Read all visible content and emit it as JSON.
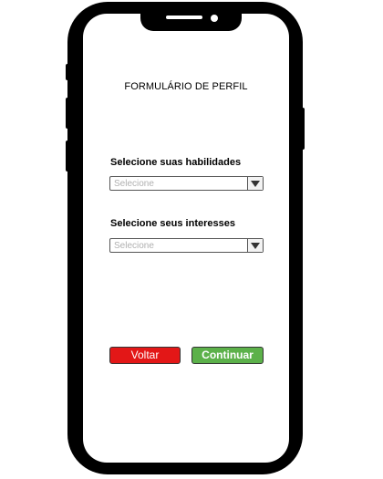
{
  "form": {
    "title": "FORMULÁRIO DE PERFIL",
    "skills": {
      "label": "Selecione suas habilidades",
      "placeholder": "Selecione"
    },
    "interests": {
      "label": "Selecione seus interesses",
      "placeholder": "Selecione"
    }
  },
  "actions": {
    "back_label": "Voltar",
    "continue_label": "Continuar"
  },
  "colors": {
    "back": "#e31717",
    "continue": "#5cb14a",
    "frame": "#000000"
  },
  "icons": {
    "dropdown": "triangle-down-icon"
  }
}
